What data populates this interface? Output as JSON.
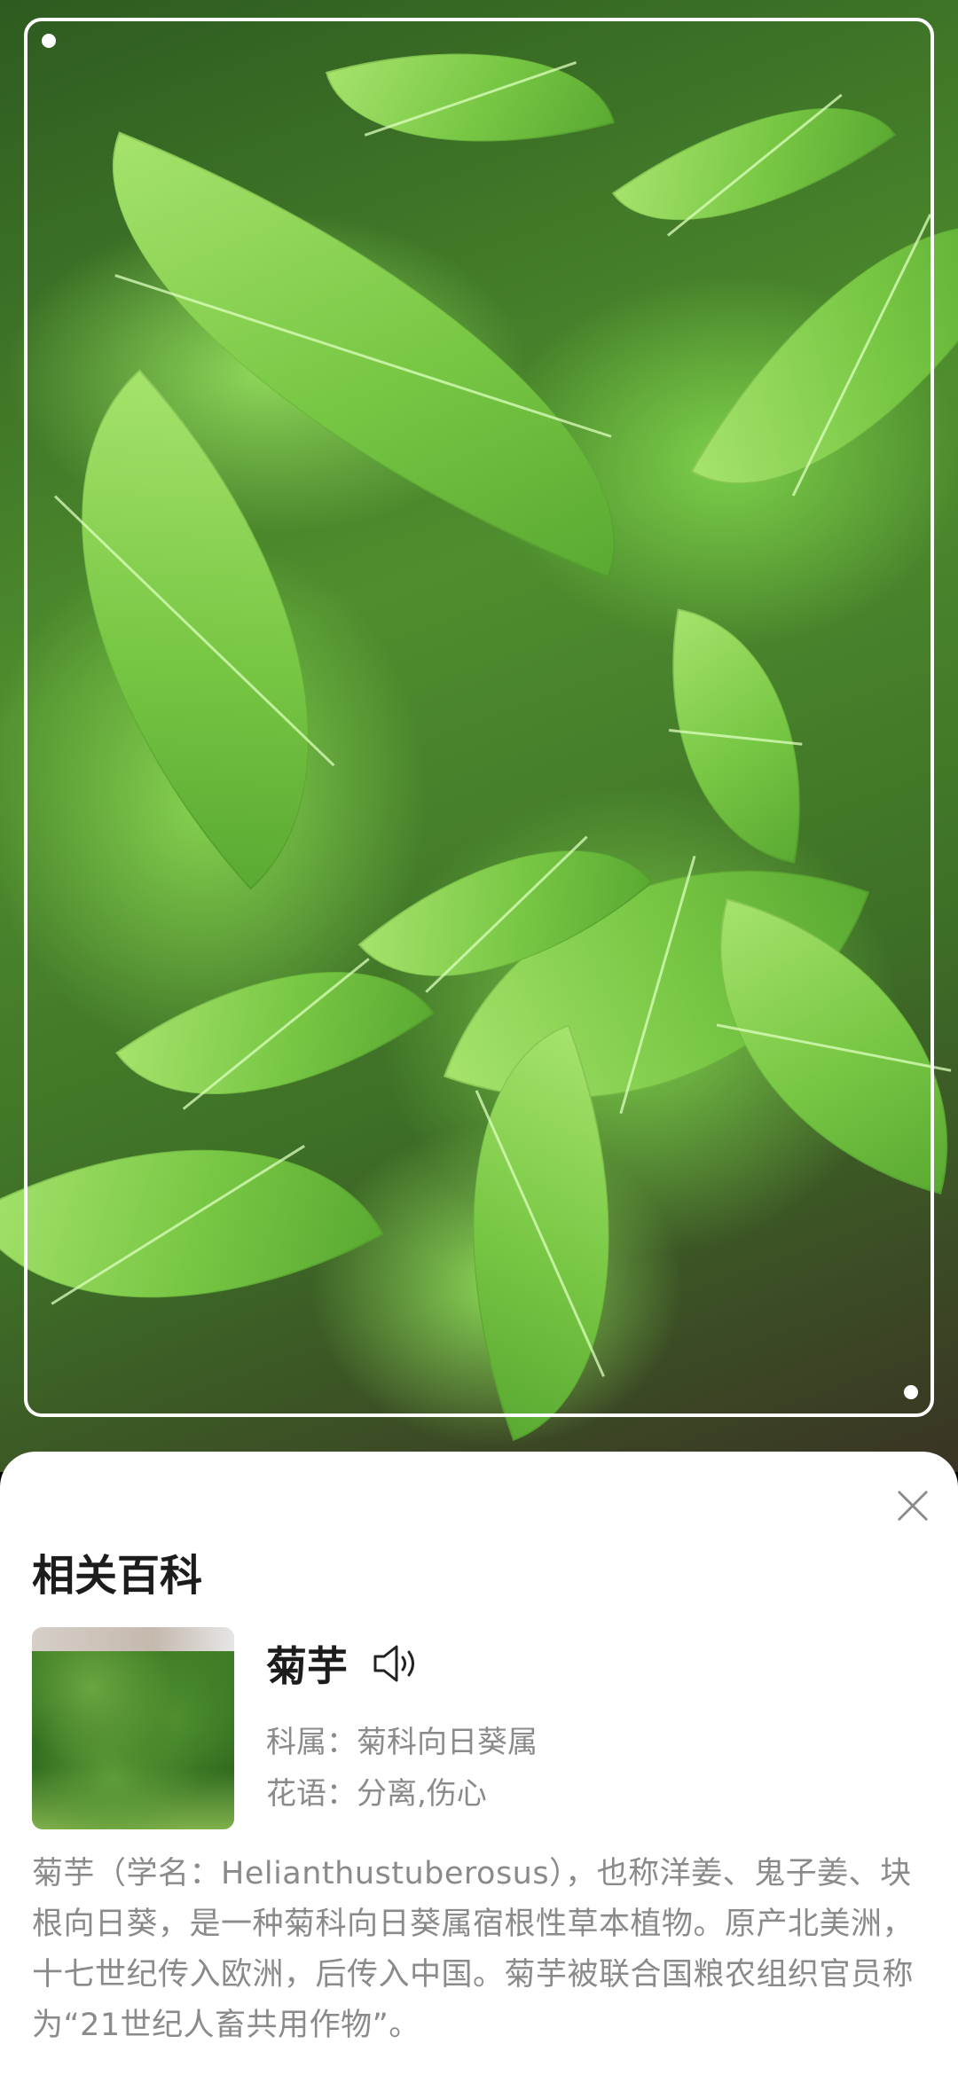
{
  "photo": {
    "icon": "plant-photo"
  },
  "sheet": {
    "close_icon": "close-icon",
    "section_title": "相关百科",
    "plant": {
      "name": "菊芋",
      "speaker_icon": "speaker-icon",
      "family_label": "科属：",
      "family_value": "菊科向日葵属",
      "flower_language_label": "花语：",
      "flower_language_value": "分离,伤心"
    },
    "description": "菊芋（学名：Helianthustuberosus），也称洋姜、鬼子姜、块根向日葵，是一种菊科向日葵属宿根性草本植物。原产北美洲，十七世纪传入欧洲，后传入中国。菊芋被联合国粮农组织官员称为“21世纪人畜共用作物”。"
  }
}
